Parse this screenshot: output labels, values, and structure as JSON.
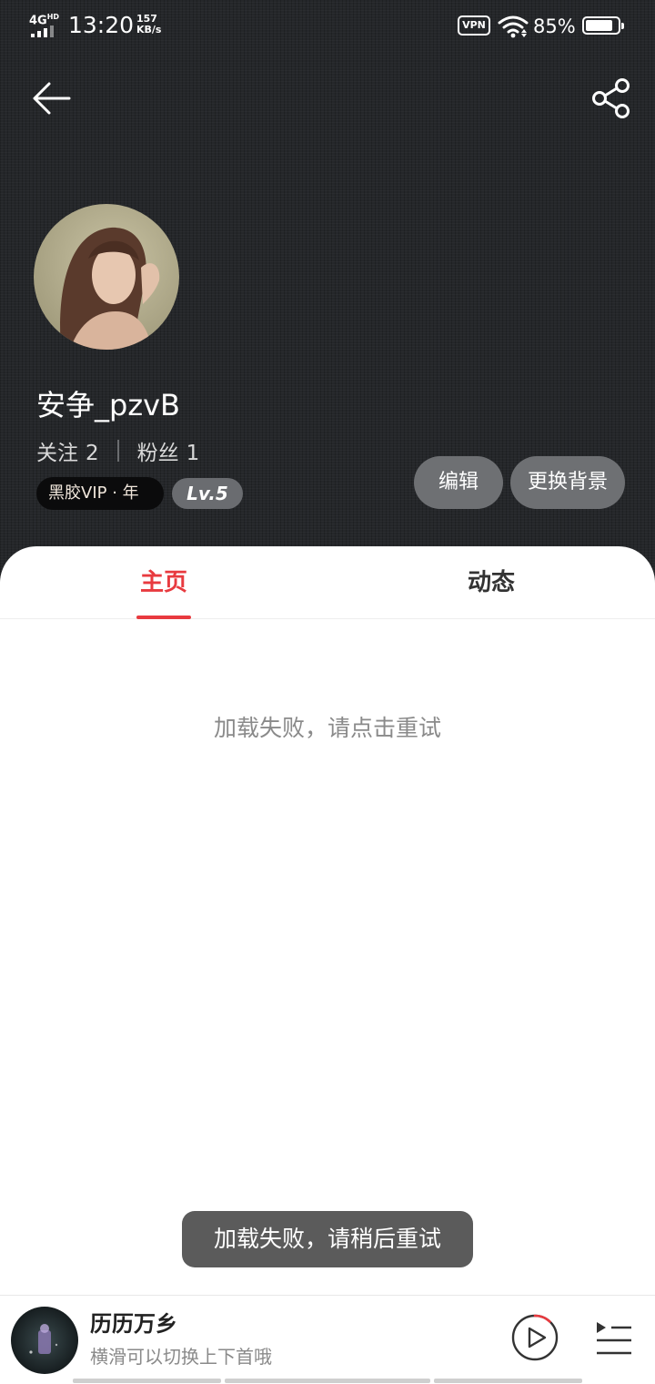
{
  "status_bar": {
    "network": "4G",
    "network_sup": "HD",
    "time": "13:20",
    "speed_value": "157",
    "speed_unit": "KB/s",
    "vpn": "VPN",
    "battery_text": "85%",
    "battery_level": 0.85
  },
  "nav": {
    "back_icon": "arrow-left-icon",
    "share_icon": "share-icon"
  },
  "profile": {
    "username": "安争_pzvB",
    "following_label": "关注",
    "following_count": "2",
    "fans_label": "粉丝",
    "fans_count": "1",
    "vip_badge": "黑胶VIP · 年",
    "level": "Lv.5",
    "edit_label": "编辑",
    "change_bg_label": "更换背景"
  },
  "tabs": [
    {
      "label": "主页",
      "active": true
    },
    {
      "label": "动态",
      "active": false
    }
  ],
  "content": {
    "load_error": "加载失败，请点击重试"
  },
  "toast": "加载失败，请稍后重试",
  "player": {
    "title": "历历万乡",
    "subtitle": "横滑可以切换上下首哦",
    "playback_progress": 0.12
  },
  "colors": {
    "accent": "#e83a3f",
    "header_bg": "#25272a",
    "pill_bg": "#6e7073"
  }
}
